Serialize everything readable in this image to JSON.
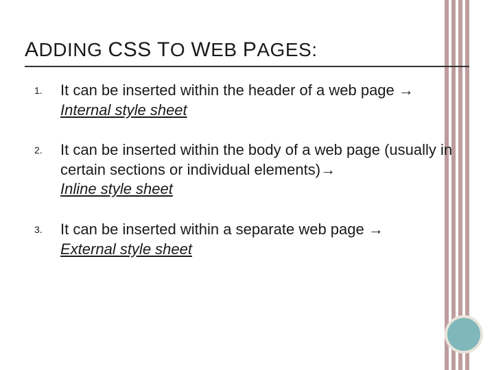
{
  "title": {
    "w1_first": "A",
    "w1_rest": "DDING",
    "w2": "CSS",
    "w3_first": "T",
    "w3_rest": "O",
    "w4_first": "W",
    "w4_rest": "EB",
    "w5_first": "P",
    "w5_rest": "AGES",
    "colon": ":"
  },
  "arrow": "→",
  "items": [
    {
      "num": "1.",
      "pre": "It can be inserted within the header of a web page ",
      "em": "Internal style sheet",
      "post": ""
    },
    {
      "num": "2.",
      "pre": "It can be inserted within the body of a web page (usually in certain sections or individual elements)",
      "em": "Inline style sheet",
      "post": ""
    },
    {
      "num": "3.",
      "pre": "It can be inserted within a separate web page ",
      "em": "External style sheet",
      "post": ""
    }
  ]
}
